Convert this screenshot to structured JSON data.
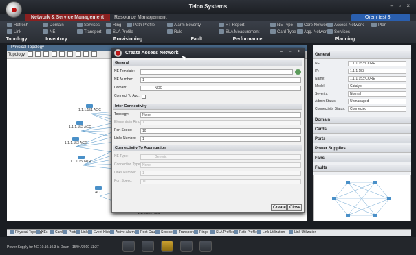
{
  "app": {
    "title": "Telco Systems",
    "window_controls": "– ▫ ×",
    "tabs": [
      "Network & Service Management",
      "Resource Management"
    ],
    "user": "Orem test 3"
  },
  "ribbon": {
    "buttons_row1": [
      "Refresh",
      "Domain",
      "Services",
      "Ring",
      "Path Profile",
      "Alarm Severity",
      "RT Report",
      "NE Type",
      "Core Network",
      "Access Network",
      "Plan"
    ],
    "buttons_row2": [
      "Link",
      "NE",
      "Transport",
      "SLA Profile",
      "Rule",
      "SLA Measurement",
      "Card Type",
      "Agg. Network",
      "Services"
    ],
    "groups": [
      "Topology",
      "Inventory",
      "Provisioning",
      "Fault",
      "Performance",
      "Planning"
    ]
  },
  "left_panel": {
    "header": "Physical Topology",
    "toolbar_label": "Topology",
    "nodes": [
      {
        "label": "1.1.1.151 AGC"
      },
      {
        "label": "1.1.1.152 AGC"
      },
      {
        "label": "1.1.1.153 AGC"
      },
      {
        "label": "1.1.1.150 AGC"
      },
      {
        "label": "ACC"
      },
      {
        "label": "1.1.1.151 ACC"
      }
    ]
  },
  "dialog": {
    "title": "Create Access Network",
    "sections": {
      "general": "General",
      "inter": "Inter Connectivity",
      "aggregation": "Connectivity To Aggregation"
    },
    "general": {
      "ne_template_label": "NE Template:",
      "ne_template_value": "",
      "ne_number_label": "NE Number:",
      "ne_number_value": "1",
      "domain_label": "Domain:",
      "domain_value": "NOC",
      "connect_to_agg_label": "Connect To Agg:"
    },
    "inter": {
      "topology_label": "Topology:",
      "topology_value": "None",
      "elements_label": "Elements in Ring:",
      "elements_value": "1",
      "port_speed_label": "Port Speed:",
      "port_speed_value": "10",
      "links_label": "Links Number:",
      "links_value": "1"
    },
    "aggregation": {
      "ne_type_label": "NE Type:",
      "ne_type_value": "Generic",
      "conn_type_label": "Connection Type:",
      "conn_type_value": "None",
      "links_label": "Links Number:",
      "links_value": "1",
      "port_speed_label": "Port Speed:",
      "port_speed_value": "10"
    },
    "buttons": {
      "create": "Create",
      "close": "Close"
    }
  },
  "right_panel": {
    "sections": [
      "General",
      "Domain",
      "Cards",
      "Ports",
      "Power Supplies",
      "Fans",
      "Faults"
    ],
    "general": [
      {
        "label": "NE:",
        "value": "1.1.1.153:CORE"
      },
      {
        "label": "IP:",
        "value": "1.1.1.153"
      },
      {
        "label": "Name:",
        "value": "1.1.1.153:CORE"
      },
      {
        "label": "Model:",
        "value": "Catalyst"
      },
      {
        "label": "Severity:",
        "value": "Normal"
      },
      {
        "label": "Admin Status:",
        "value": "Unmanaged"
      },
      {
        "label": "Connectivity Status:",
        "value": "Connected"
      }
    ]
  },
  "bottom_tabs": [
    "Physical Topology",
    "NEs",
    "Cards",
    "Ports",
    "Links",
    "Event History",
    "Active Alarms",
    "Root Cause",
    "Services",
    "Transports",
    "Rings",
    "SLA Profiles",
    "Path Profiles",
    "Link Utilization",
    "Link Utilization"
  ],
  "status": {
    "text": "Power Supply for NE 10.10.10.3 is Down - 15/04/2010  11:27"
  },
  "colors": {
    "accent": "#8a2020",
    "selection": "#2a5fae",
    "node": "#4a90c8"
  }
}
